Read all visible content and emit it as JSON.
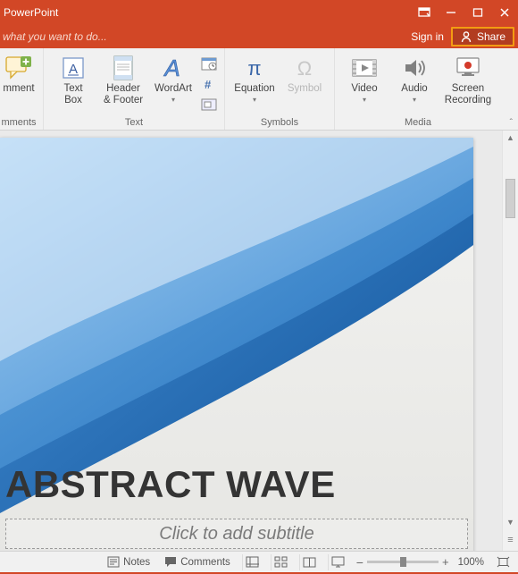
{
  "titlebar": {
    "app": "PowerPoint"
  },
  "accountbar": {
    "tell_me": "what you want to do...",
    "signin": "Sign in",
    "share": "Share"
  },
  "ribbon": {
    "comment": {
      "label": "mment",
      "group": "mments"
    },
    "text": {
      "textbox": "Text\nBox",
      "header": "Header\n& Footer",
      "wordart": "WordArt",
      "group": "Text"
    },
    "symbols": {
      "equation": "Equation",
      "symbol": "Symbol",
      "group": "Symbols"
    },
    "media": {
      "video": "Video",
      "audio": "Audio",
      "screen": "Screen\nRecording",
      "group": "Media"
    }
  },
  "slide": {
    "title": "ABSTRACT WAVE",
    "subtitle_placeholder": "Click to add subtitle"
  },
  "statusbar": {
    "notes": "Notes",
    "comments": "Comments",
    "zoom_pct": "100%"
  }
}
